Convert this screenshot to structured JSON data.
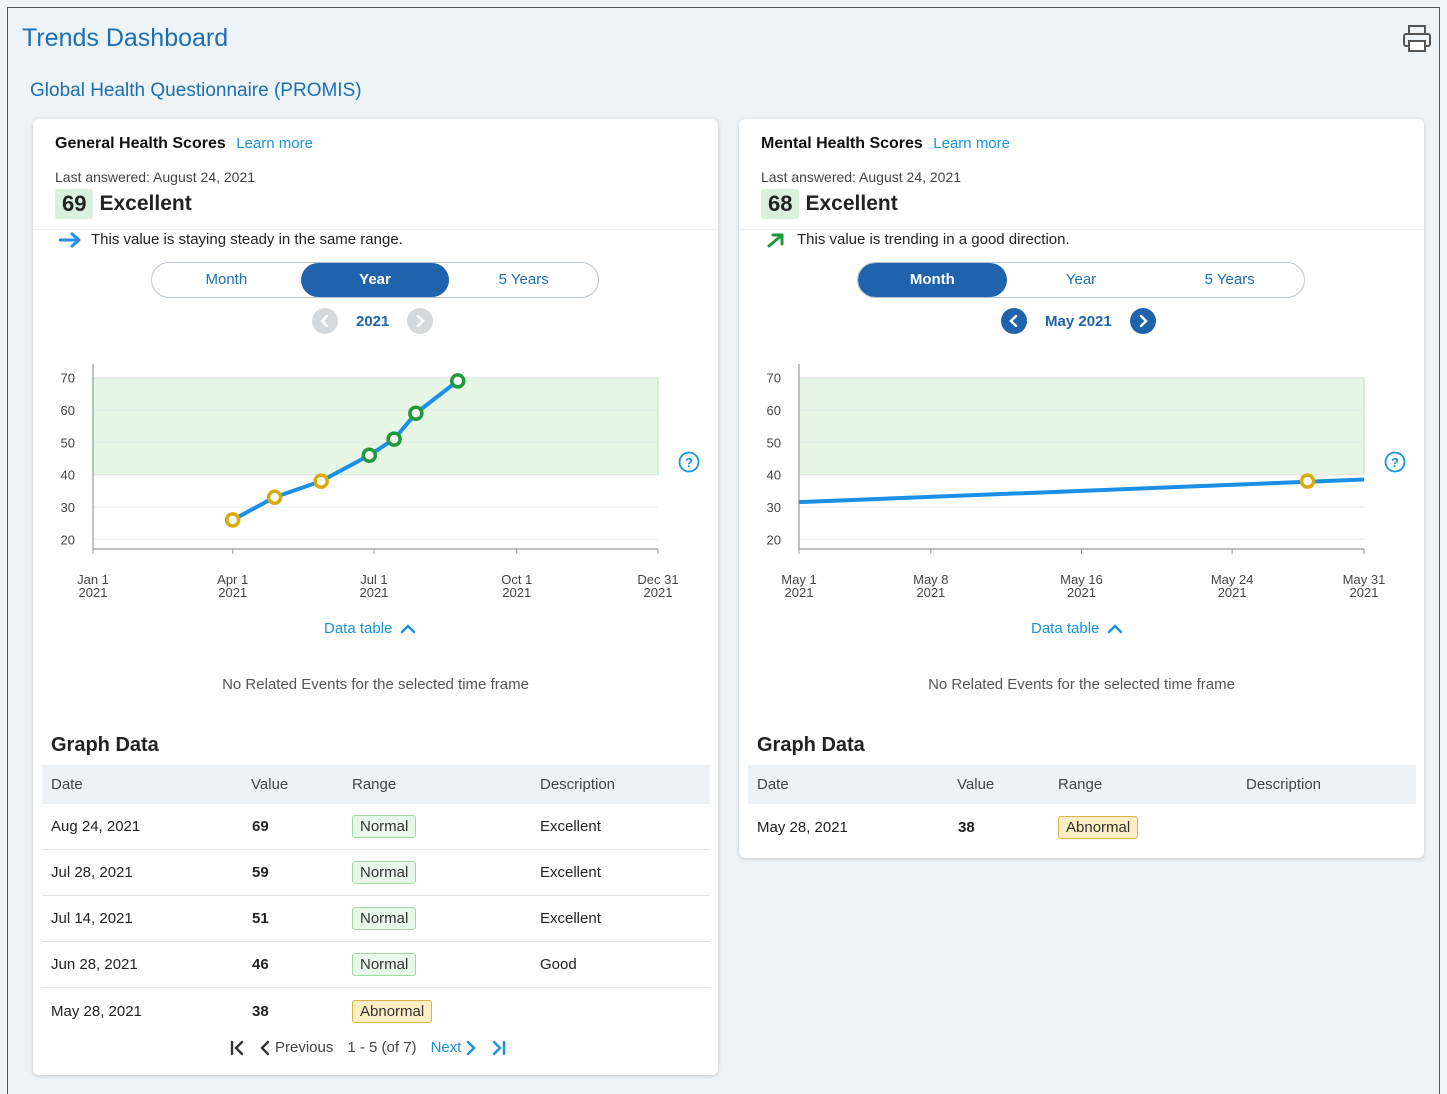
{
  "page_title": "Trends Dashboard",
  "section_title": "Global Health Questionnaire (PROMIS)",
  "colors": {
    "brand": "#1b6fb2",
    "link": "#1795d8",
    "toggle_active": "#1e63ab",
    "normal_range_fill": "#e6f7e6",
    "line": "#1a8fe6",
    "point_normal": "#1e9a3a",
    "point_abnormal": "#d9ab0a"
  },
  "cards": [
    {
      "title": "General Health Scores",
      "learn_more": "Learn more",
      "last_answered": "Last answered: August 24, 2021",
      "score": "69",
      "score_label": "Excellent",
      "trend_text": "This value is staying steady in the same range.",
      "trend_icon": "arrow-right-icon",
      "toggle": [
        "Month",
        "Year",
        "5 Years"
      ],
      "toggle_active": "Year",
      "period": "2021",
      "data_table_label": "Data table",
      "no_events": "No Related Events for the selected time frame",
      "graph_data_title": "Graph Data",
      "table_headers": [
        "Date",
        "Value",
        "Range",
        "Description"
      ],
      "rows": [
        {
          "date": "Aug 24, 2021",
          "value": "69",
          "range": "Normal",
          "description": "Excellent"
        },
        {
          "date": "Jul 28, 2021",
          "value": "59",
          "range": "Normal",
          "description": "Excellent"
        },
        {
          "date": "Jul 14, 2021",
          "value": "51",
          "range": "Normal",
          "description": "Excellent"
        },
        {
          "date": "Jun 28, 2021",
          "value": "46",
          "range": "Normal",
          "description": "Good"
        },
        {
          "date": "May 28, 2021",
          "value": "38",
          "range": "Abnormal",
          "description": ""
        }
      ],
      "pager": {
        "previous": "Previous",
        "range_text": "1 - 5 (of 7)",
        "next": "Next"
      }
    },
    {
      "title": "Mental Health Scores",
      "learn_more": "Learn more",
      "last_answered": "Last answered: August 24, 2021",
      "score": "68",
      "score_label": "Excellent",
      "trend_text": "This value is trending in a good direction.",
      "trend_icon": "arrow-up-right-icon",
      "toggle": [
        "Month",
        "Year",
        "5 Years"
      ],
      "toggle_active": "Month",
      "period": "May 2021",
      "data_table_label": "Data table",
      "no_events": "No Related Events for the selected time frame",
      "graph_data_title": "Graph Data",
      "table_headers": [
        "Date",
        "Value",
        "Range",
        "Description"
      ],
      "rows": [
        {
          "date": "May 28, 2021",
          "value": "38",
          "range": "Abnormal",
          "description": ""
        }
      ]
    }
  ],
  "chart_data": [
    {
      "type": "line",
      "title": "",
      "xlabel": "",
      "ylabel": "",
      "ylim": [
        17,
        73
      ],
      "yticks": [
        20,
        30,
        40,
        50,
        60,
        70
      ],
      "x_tick_labels": [
        [
          "Jan 1",
          "2021"
        ],
        [
          "Apr 1",
          "2021"
        ],
        [
          "Jul 1",
          "2021"
        ],
        [
          "Oct 1",
          "2021"
        ],
        [
          "Dec 31",
          "2021"
        ]
      ],
      "x_domain": [
        "2021-01-01",
        "2021-12-31"
      ],
      "x_ticks": [
        "2021-01-01",
        "2021-04-01",
        "2021-07-01",
        "2021-10-01",
        "2021-12-31"
      ],
      "normal_range": [
        40,
        70
      ],
      "points": [
        {
          "x": "2021-04-01",
          "y": 26,
          "range": "Abnormal"
        },
        {
          "x": "2021-04-28",
          "y": 33,
          "range": "Abnormal"
        },
        {
          "x": "2021-05-28",
          "y": 38,
          "range": "Abnormal"
        },
        {
          "x": "2021-06-28",
          "y": 46,
          "range": "Normal"
        },
        {
          "x": "2021-07-14",
          "y": 51,
          "range": "Normal"
        },
        {
          "x": "2021-07-28",
          "y": 59,
          "range": "Normal"
        },
        {
          "x": "2021-08-24",
          "y": 69,
          "range": "Normal"
        }
      ],
      "line_through_points": true
    },
    {
      "type": "line",
      "title": "",
      "xlabel": "",
      "ylabel": "",
      "ylim": [
        17,
        73
      ],
      "yticks": [
        20,
        30,
        40,
        50,
        60,
        70
      ],
      "x_tick_labels": [
        [
          "May 1",
          "2021"
        ],
        [
          "May 8",
          "2021"
        ],
        [
          "May 16",
          "2021"
        ],
        [
          "May 24",
          "2021"
        ],
        [
          "May 31",
          "2021"
        ]
      ],
      "x_domain": [
        "2021-05-01",
        "2021-05-31"
      ],
      "x_ticks": [
        "2021-05-01",
        "2021-05-08",
        "2021-05-16",
        "2021-05-24",
        "2021-05-31"
      ],
      "normal_range": [
        40,
        70
      ],
      "points": [
        {
          "x": "2021-05-28",
          "y": 38,
          "range": "Abnormal"
        }
      ],
      "line": [
        {
          "x": "2021-05-01",
          "y": 31.5
        },
        {
          "x": "2021-05-31",
          "y": 38.5
        }
      ]
    }
  ]
}
